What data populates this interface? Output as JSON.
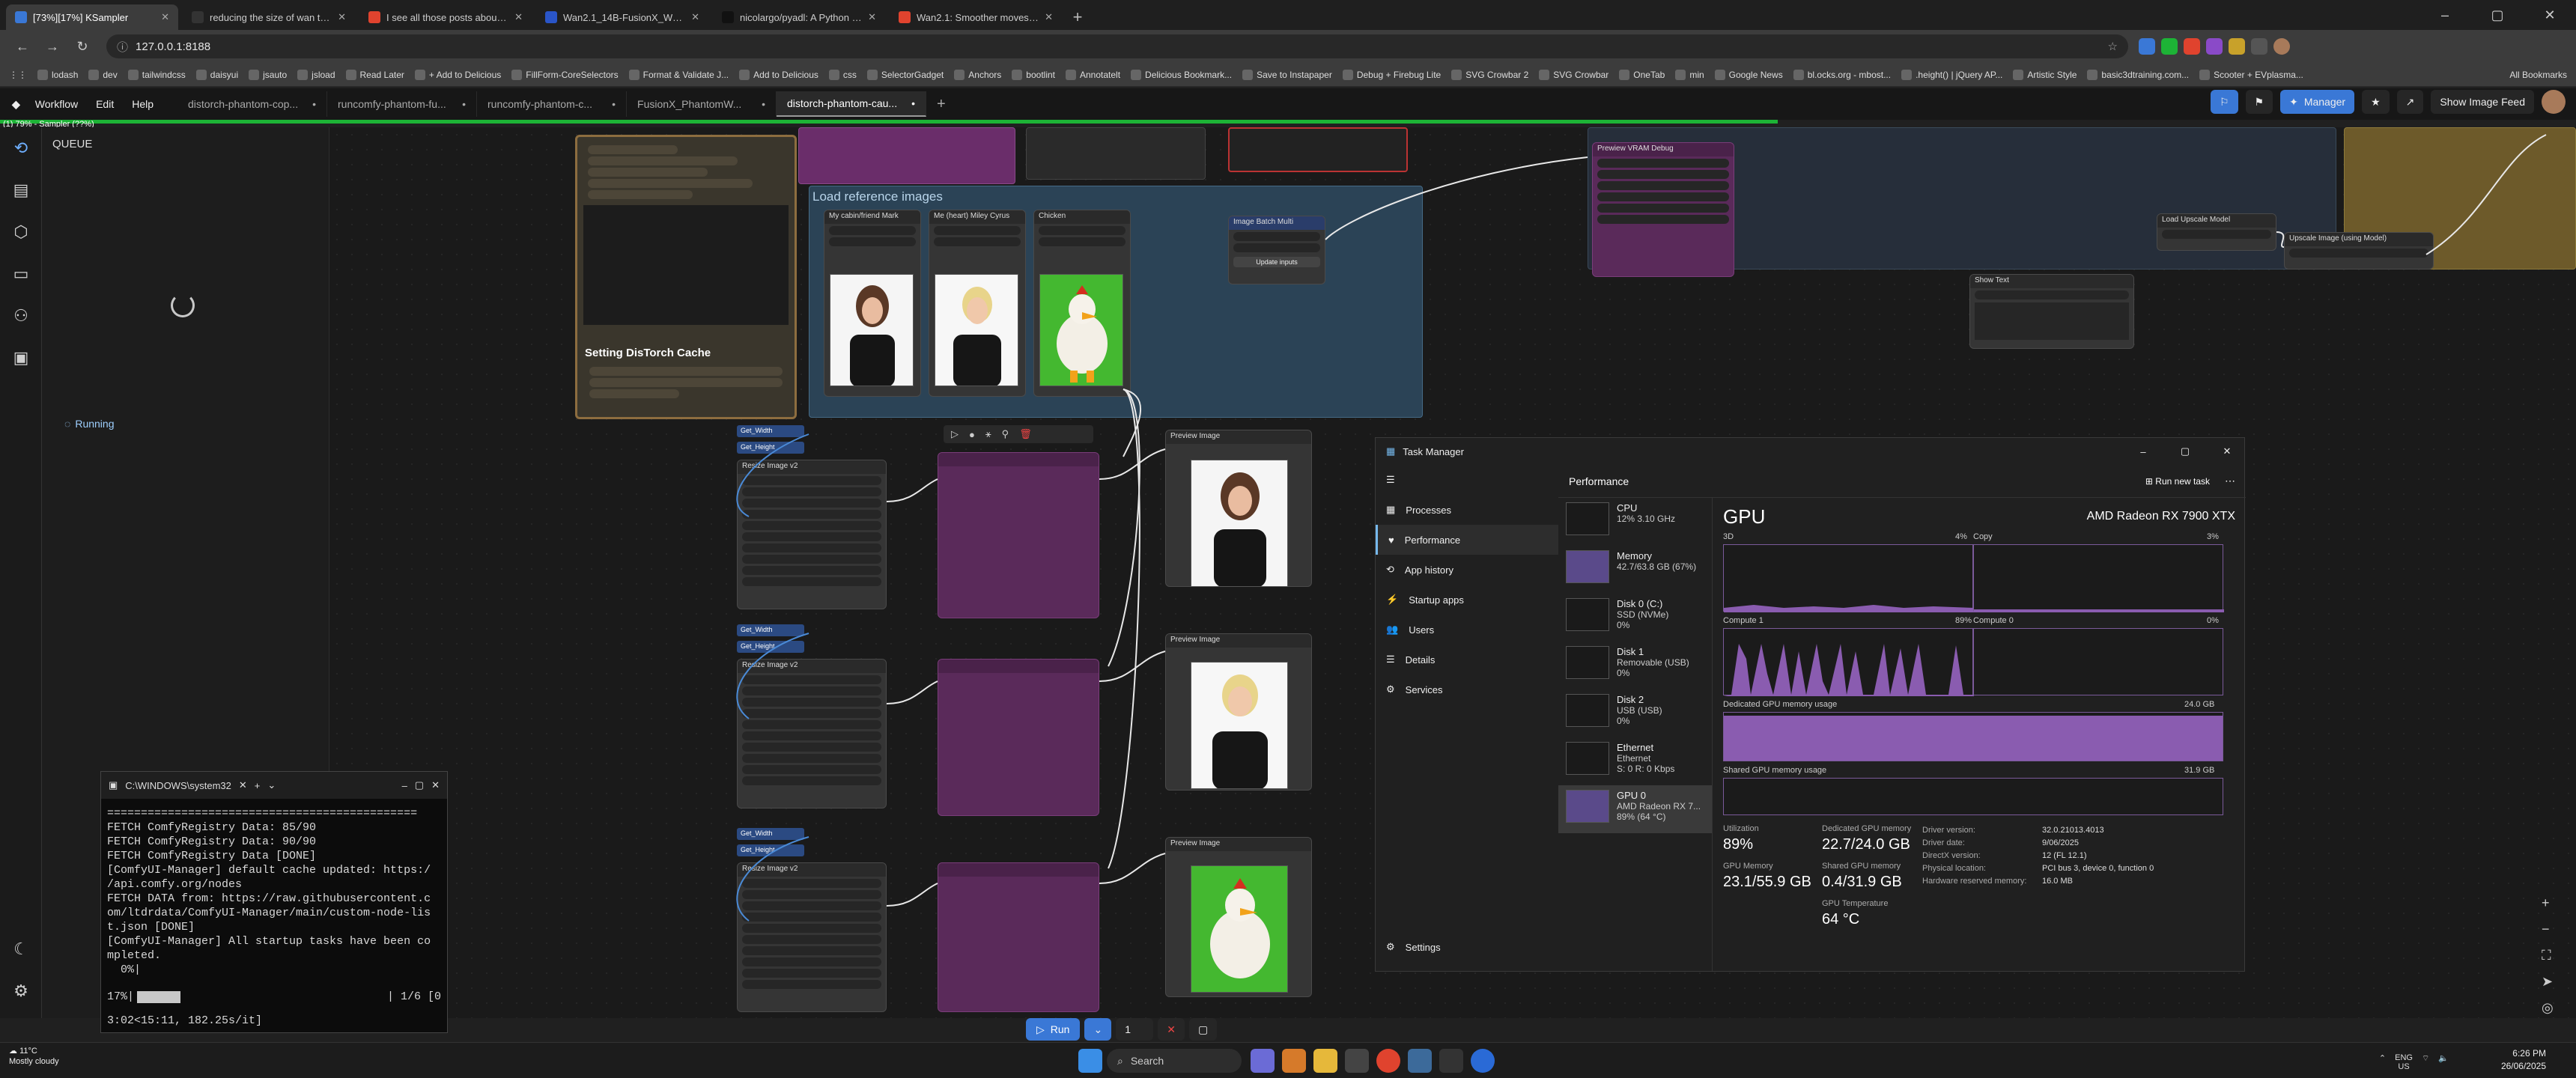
{
  "browser": {
    "tabs": [
      {
        "title": "[73%][17%] KSampler",
        "active": true,
        "fav": "#3a78d6"
      },
      {
        "title": "reducing the size of wan t2v Fu",
        "active": false,
        "fav": "#333"
      },
      {
        "title": "I see all those posts about Fu",
        "active": false,
        "fav": "#e0432e"
      },
      {
        "title": "Wan2.1_14B-FusionX_Workflo",
        "active": false,
        "fav": "#2a55c8"
      },
      {
        "title": "nicolargo/pyadl: A Python wrap",
        "active": false,
        "fav": "#111"
      },
      {
        "title": "Wan2.1: Smoother moves and",
        "active": false,
        "fav": "#e0432e"
      }
    ],
    "url": "127.0.0.1:8188",
    "bookmarks": [
      "lodash",
      "dev",
      "tailwindcss",
      "daisyui",
      "jsauto",
      "jsload",
      "Read Later",
      "+ Add to Delicious",
      "FillForm-CoreSelectors",
      "Format & Validate J...",
      "Add to Delicious",
      "css",
      "SelectorGadget",
      "Anchors",
      "bootlint",
      "Annotatelt",
      "Delicious Bookmark...",
      "Save to Instapaper",
      "Debug + Firebug Lite",
      "SVG Crowbar 2",
      "SVG Crowbar",
      "OneTab",
      "min",
      "Google News",
      "bl.ocks.org - mbost...",
      ".height() | jQuery AP...",
      "Artistic Style",
      "basic3dtraining.com...",
      "Scooter + EVplasma..."
    ],
    "all_bookmarks": "All Bookmarks"
  },
  "comfy": {
    "menu": [
      "Workflow",
      "Edit",
      "Help"
    ],
    "workflow_tabs": [
      "distorch-phantom-cop...",
      "runcomfy-phantom-fu...",
      "runcomfy-phantom-c...",
      "FusionX_PhantomW...",
      "distorch-phantom-cau..."
    ],
    "status": "(1) 79% - Sampler (??%)",
    "manager_label": "Manager",
    "feed_label": "Show Image Feed",
    "queue_title": "QUEUE",
    "running_label": "Running",
    "run_label": "Run",
    "run_count": "1",
    "progress": 0.69
  },
  "canvas": {
    "note_title": "Setting DisTorch Cache",
    "load_group": "Load reference images",
    "load_nodes": [
      "My cabin/friend Mark",
      "Me (heart) Miley Cyrus",
      "Chicken"
    ],
    "batch_node": "Image Batch Multi",
    "batch_button": "Update inputs",
    "preview_label": "Preview Image",
    "resize_label": "Resize Image v2",
    "get_width": "Get_Width",
    "get_height": "Get_Height",
    "vram_node": "Prewiew VRAM Debug",
    "upscale_loader": "Load Upscale Model",
    "upscale_node": "Upscale Image (using Model)",
    "show_text": "Show Text"
  },
  "terminal": {
    "title": "C:\\WINDOWS\\system32",
    "lines": [
      "==============================================",
      "FETCH ComfyRegistry Data: 85/90",
      "FETCH ComfyRegistry Data: 90/90",
      "FETCH ComfyRegistry Data [DONE]",
      "[ComfyUI-Manager] default cache updated: https:/",
      "/api.comfy.org/nodes",
      "FETCH DATA from: https://raw.githubusercontent.c",
      "om/ltdrdata/ComfyUI-Manager/main/custom-node-lis",
      "t.json [DONE]",
      "[ComfyUI-Manager] All startup tasks have been co",
      "mpleted.",
      "  0%|"
    ],
    "progress_pct": "17%|",
    "progress_steps": "| 1/6 [0",
    "progress_time": "3:02<15:11, 182.25s/it]",
    "progress_fraction": 0.17
  },
  "taskmgr": {
    "title": "Task Manager",
    "nav": [
      "Processes",
      "Performance",
      "App history",
      "Startup apps",
      "Users",
      "Details",
      "Services"
    ],
    "settings": "Settings",
    "header": "Performance",
    "run_task": "Run new task",
    "perf_items": [
      {
        "name": "CPU",
        "sub": "12% 3.10 GHz"
      },
      {
        "name": "Memory",
        "sub": "42.7/63.8 GB (67%)"
      },
      {
        "name": "Disk 0 (C:)",
        "sub": "SSD (NVMe)",
        "val": "0%"
      },
      {
        "name": "Disk 1",
        "sub": "Removable (USB)",
        "val": "0%"
      },
      {
        "name": "Disk 2",
        "sub": "USB (USB)",
        "val": "0%"
      },
      {
        "name": "Ethernet",
        "sub": "Ethernet",
        "val": "S: 0 R: 0 Kbps"
      },
      {
        "name": "GPU 0",
        "sub": "AMD Radeon RX 7...",
        "val": "89% (64 °C)"
      }
    ],
    "gpu_title": "GPU",
    "gpu_model": "AMD Radeon RX 7900 XTX",
    "graphs": {
      "3d": {
        "label": "3D",
        "pct": "4%"
      },
      "copy": {
        "label": "Copy",
        "pct": "3%"
      },
      "compute1": {
        "label": "Compute 1",
        "pct": "89%"
      },
      "compute0": {
        "label": "Compute 0",
        "pct": "0%"
      }
    },
    "dedicated_label": "Dedicated GPU memory usage",
    "dedicated_max": "24.0 GB",
    "shared_label": "Shared GPU memory usage",
    "shared_max": "31.9 GB",
    "dedicated_fraction": 0.94,
    "stats": {
      "utilization_label": "Utilization",
      "utilization": "89%",
      "gpu_memory_label": "GPU Memory",
      "gpu_memory": "23.1/55.9 GB",
      "dedicated_label": "Dedicated GPU memory",
      "dedicated": "22.7/24.0 GB",
      "shared_label": "Shared GPU memory",
      "shared": "0.4/31.9 GB",
      "temp_label": "GPU Temperature",
      "temp": "64 °C"
    },
    "info": [
      [
        "Driver version:",
        "32.0.21013.4013"
      ],
      [
        "Driver date:",
        "9/06/2025"
      ],
      [
        "DirectX version:",
        "12 (FL 12.1)"
      ],
      [
        "Physical location:",
        "PCI bus 3, device 0, function 0"
      ],
      [
        "Hardware reserved memory:",
        "16.0 MB"
      ]
    ]
  },
  "taskbar": {
    "temp": "11°C",
    "weather": "Mostly cloudy",
    "search": "Search",
    "lang": "ENG",
    "region": "US",
    "time": "6:26 PM",
    "date": "26/06/2025"
  },
  "colors": {
    "accent": "#3a78d6",
    "progress": "#1db336",
    "purple": "#5a2a5a"
  }
}
